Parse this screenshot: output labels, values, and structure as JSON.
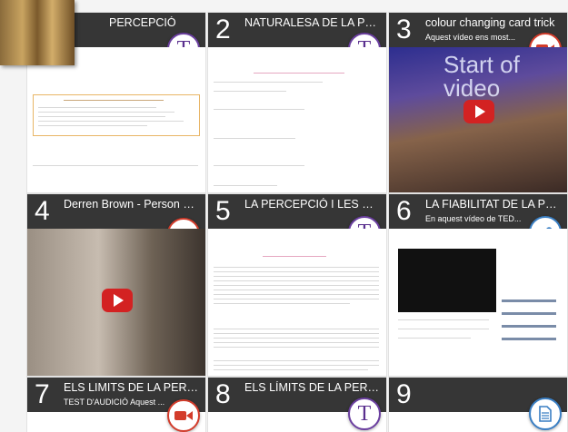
{
  "tiles": [
    {
      "num": "",
      "title": "PERCEPCIÓ",
      "subtitle": "",
      "type": "text-icon"
    },
    {
      "num": "2",
      "title": "NATURALESA DE LA PERC...",
      "subtitle": "",
      "type": "text-icon"
    },
    {
      "num": "3",
      "title": "colour changing card trick",
      "subtitle": "Aquest vídeo ens most...",
      "type": "video-icon",
      "video_caption": "Start of video"
    },
    {
      "num": "4",
      "title": "Derren Brown - Person Swap",
      "subtitle": "",
      "type": "video-icon"
    },
    {
      "num": "5",
      "title": "LA PERCEPCIÓ I LES EXPEC...",
      "subtitle": "",
      "type": "text-icon"
    },
    {
      "num": "6",
      "title": "LA FIABILITAT DE LA PERCE...",
      "subtitle": "En aquest vídeo de TED...",
      "type": "link-icon"
    },
    {
      "num": "7",
      "title": "ELS LIMITS DE LA PERCEPCIÓ",
      "subtitle": "TEST D'AUDICIÓ Aquest ...",
      "type": "video-icon"
    },
    {
      "num": "8",
      "title": "ELS LÍMITS DE LA PERCEPCIÓ",
      "subtitle": "",
      "type": "text-icon"
    },
    {
      "num": "9",
      "title": "",
      "subtitle": "",
      "type": "document-icon"
    }
  ],
  "badge_text_letter": "T",
  "colors": {
    "header": "#363636",
    "text_badge": "#5a2f8e",
    "video_badge": "#d33c2b",
    "link_badge": "#3a7fc4",
    "play_button": "#d32222"
  }
}
